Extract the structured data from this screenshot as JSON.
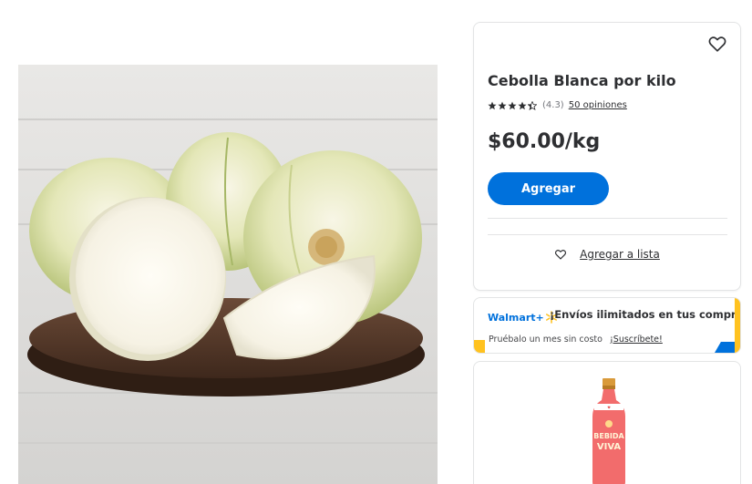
{
  "product": {
    "title": "Cebolla Blanca por kilo",
    "rating": 4.3,
    "rating_text": "(4.3)",
    "reviews_text": "50 opiniones",
    "price": "$60.00/kg",
    "add_button_label": "Agregar",
    "add_to_list_label": "Agregar a lista"
  },
  "banner": {
    "logo_text": "Walmart+",
    "headline": "¡Envíos ilimitados en tus compras!",
    "subtext": "Pruébalo un mes sin costo",
    "link_text": "¡Suscríbete!"
  },
  "promo": {
    "bottle_brand": "BEBIDA VIVA",
    "bottle_line1": "BEBIDA",
    "bottle_line2": "VIVA"
  },
  "colors": {
    "accent": "#0071dc",
    "yellow": "#ffc220"
  },
  "icons": {
    "favorite": "heart-icon",
    "list": "heart-icon",
    "spark": "spark-icon"
  }
}
